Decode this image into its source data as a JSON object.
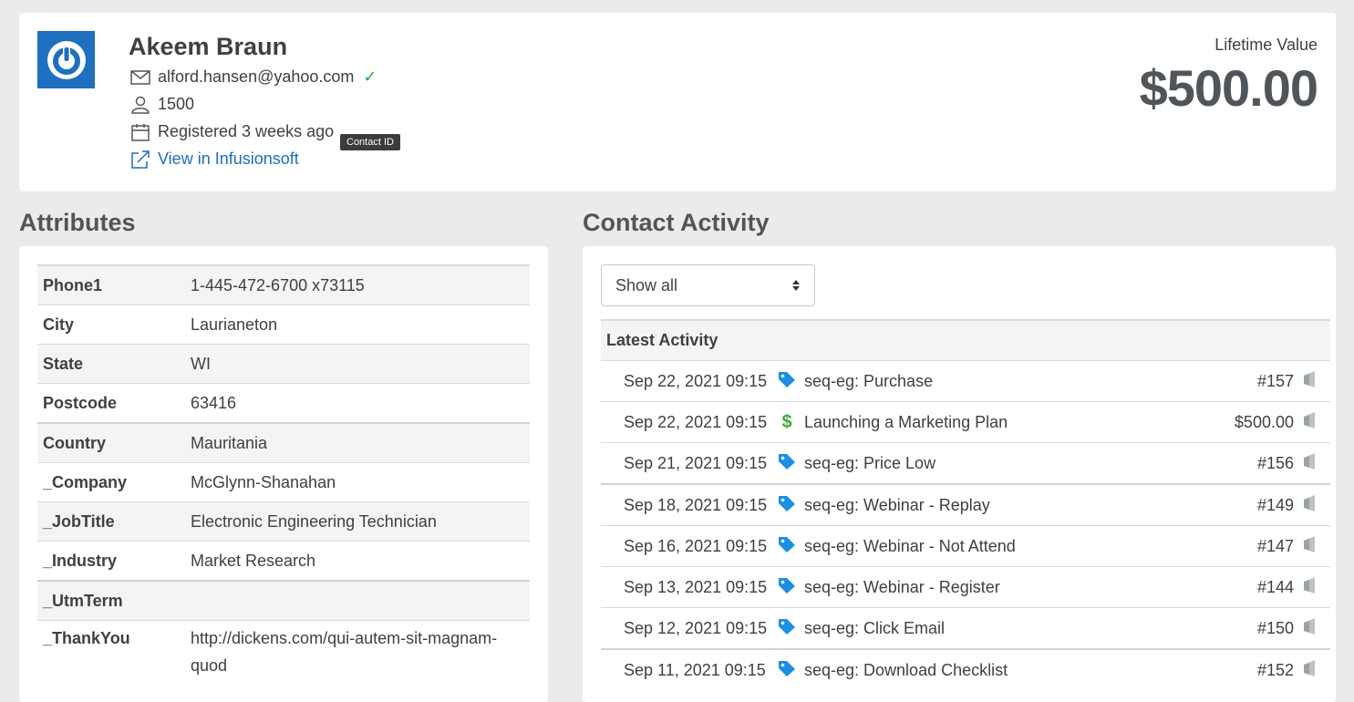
{
  "contact": {
    "name": "Akeem Braun",
    "email": "alford.hansen@yahoo.com",
    "id": "1500",
    "registered": "Registered 3 weeks ago",
    "link_label": "View in Infusionsoft",
    "tooltip": "Contact ID"
  },
  "ltv": {
    "label": "Lifetime Value",
    "value": "$500.00"
  },
  "attributes": {
    "title": "Attributes",
    "rows": [
      {
        "key": "Phone1",
        "value": "1-445-472-6700 x73115"
      },
      {
        "key": "City",
        "value": "Laurianeton"
      },
      {
        "key": "State",
        "value": "WI"
      },
      {
        "key": "Postcode",
        "value": "63416"
      },
      {
        "key": "Country",
        "value": "Mauritania"
      },
      {
        "key": "_Company",
        "value": "McGlynn-Shanahan"
      },
      {
        "key": "_JobTitle",
        "value": "Electronic Engineering Technician"
      },
      {
        "key": "_Industry",
        "value": "Market Research"
      },
      {
        "key": "_UtmTerm",
        "value": ""
      },
      {
        "key": "_ThankYou",
        "value": "http://dickens.com/qui-autem-sit-magnam-quod"
      }
    ]
  },
  "activity": {
    "title": "Contact Activity",
    "filter": "Show all",
    "header": "Latest Activity",
    "rows": [
      {
        "date": "Sep 22, 2021 09:15",
        "icon": "tag-icon",
        "text": "seq-eg: Purchase",
        "ref": "#157"
      },
      {
        "date": "Sep 22, 2021 09:15",
        "icon": "dollar-icon",
        "text": "Launching a Marketing Plan",
        "ref": "$500.00"
      },
      {
        "date": "Sep 21, 2021 09:15",
        "icon": "tag-icon",
        "text": "seq-eg: Price Low",
        "ref": "#156"
      },
      {
        "date": "Sep 18, 2021 09:15",
        "icon": "tag-icon",
        "text": "seq-eg: Webinar - Replay",
        "ref": "#149"
      },
      {
        "date": "Sep 16, 2021 09:15",
        "icon": "tag-icon",
        "text": "seq-eg: Webinar - Not Attend",
        "ref": "#147"
      },
      {
        "date": "Sep 13, 2021 09:15",
        "icon": "tag-icon",
        "text": "seq-eg: Webinar - Register",
        "ref": "#144"
      },
      {
        "date": "Sep 12, 2021 09:15",
        "icon": "tag-icon",
        "text": "seq-eg: Click Email",
        "ref": "#150"
      },
      {
        "date": "Sep 11, 2021 09:15",
        "icon": "tag-icon",
        "text": "seq-eg: Download Checklist",
        "ref": "#152"
      }
    ]
  }
}
